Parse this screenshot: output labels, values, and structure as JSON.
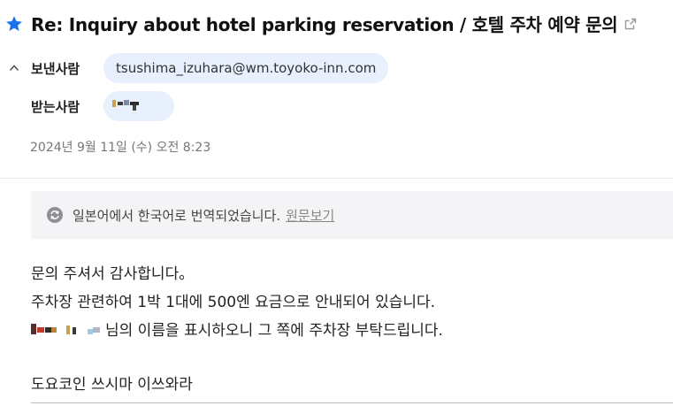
{
  "email": {
    "subject": "Re: Inquiry about hotel parking reservation / 호텔 주차 예약 문의",
    "from_label": "보낸사람",
    "from_address": "tsushima_izuhara@wm.toyoko-inn.com",
    "to_label": "받는사람",
    "date": "2024년 9월 11일 (수) 오전 8:23",
    "translation_notice": "일본어에서 한국어로 번역되었습니다.",
    "view_original_label": "원문보기",
    "body": {
      "line1": "문의 주셔서 감사합니다。",
      "line2": "주차장 관련하여 1박 1대에 500엔 요금으로 안내되어 있습니다.",
      "line3_suffix": "님의 이름을 표시하오니 그 쪽에 주차장 부탁드립니다.",
      "signature": "도요코인 쓰시마 이쓰와라"
    }
  },
  "colors": {
    "accent": "#1a73e8",
    "chip_bg": "#e8f0fe",
    "notice_bg": "#f4f4f6",
    "muted_text": "#777777"
  },
  "icons": {
    "star": "star-icon",
    "popout": "external-link-icon",
    "collapse": "chevron-up-icon",
    "translate": "translate-refresh-icon"
  }
}
